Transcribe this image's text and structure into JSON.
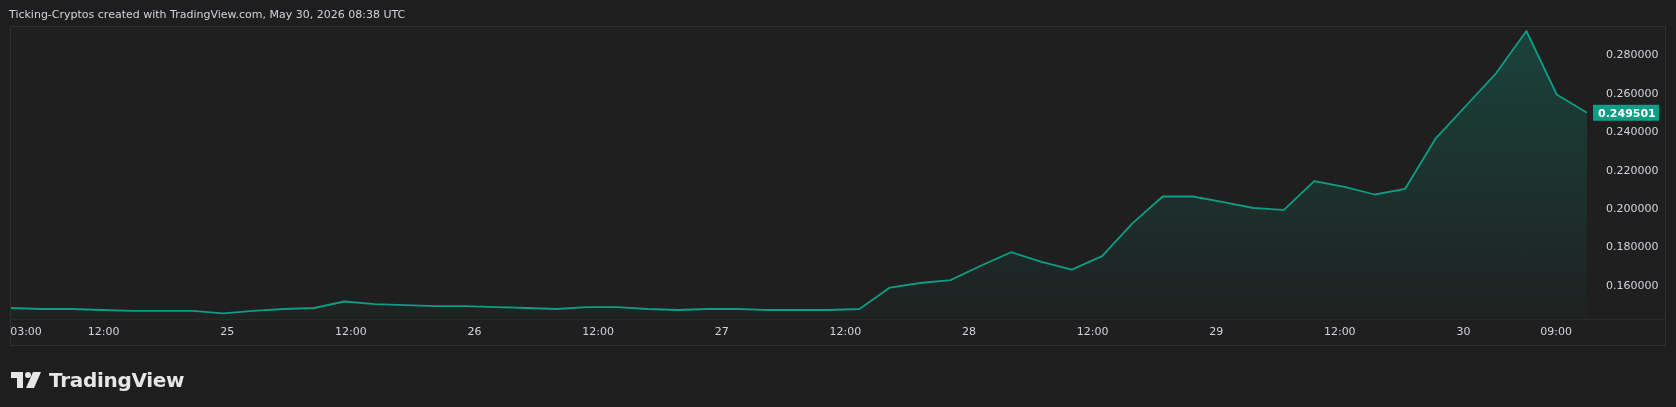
{
  "header": {
    "caption": "Ticking-Cryptos created with TradingView.com, May 30, 2026 08:38 UTC"
  },
  "chart": {
    "last_price": "0.249501",
    "chart_data": {
      "type": "area",
      "series": [
        {
          "color": "#0d9d84",
          "values": [
            0.148,
            0.1475,
            0.1475,
            0.147,
            0.1465,
            0.1465,
            0.1465,
            0.1452,
            0.1465,
            0.1475,
            0.148,
            0.1514,
            0.15,
            0.1495,
            0.149,
            0.149,
            0.1485,
            0.148,
            0.1475,
            0.1485,
            0.1485,
            0.1475,
            0.147,
            0.1475,
            0.1475,
            0.147,
            0.147,
            0.147,
            0.1475,
            0.1586,
            0.161,
            0.1625,
            0.17,
            0.177,
            0.172,
            0.168,
            0.175,
            0.192,
            0.206,
            0.206,
            0.203,
            0.2,
            0.199,
            0.214,
            0.211,
            0.207,
            0.21,
            0.236,
            0.253,
            0.27,
            0.292,
            0.259,
            0.2495
          ]
        }
      ],
      "ylim": [
        0.1423,
        0.2946
      ],
      "yticks": [
        {
          "value": 0.16,
          "label": "0.160000"
        },
        {
          "value": 0.18,
          "label": "0.180000"
        },
        {
          "value": 0.2,
          "label": "0.200000"
        },
        {
          "value": 0.22,
          "label": "0.220000"
        },
        {
          "value": 0.24,
          "label": "0.240000"
        },
        {
          "value": 0.26,
          "label": "0.260000"
        },
        {
          "value": 0.28,
          "label": "0.280000"
        }
      ]
    },
    "time_labels": [
      "03:00",
      "12:00",
      "25",
      "12:00",
      "26",
      "12:00",
      "27",
      "12:00",
      "28",
      "12:00",
      "29",
      "12:00",
      "30",
      "09:00"
    ]
  },
  "footer": {
    "brand": "TradingView"
  }
}
